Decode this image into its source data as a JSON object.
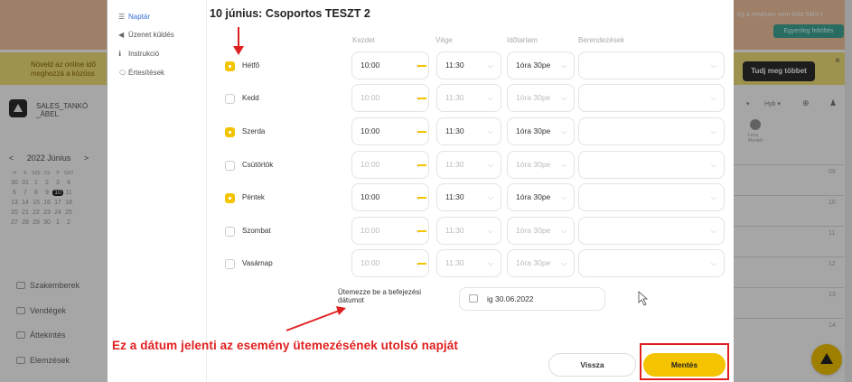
{
  "background": {
    "left_banner": "Növeld az online idő\nmeghozzá a közöss",
    "user_name": "SALES_TANKÓ\n_ÁBEL",
    "calendar": {
      "prev": "<",
      "month": "2022 Június",
      "next": ">",
      "weekdays": [
        "H",
        "K",
        "SZE",
        "CS",
        "P",
        "SZO"
      ],
      "rows": [
        [
          "30",
          "31",
          "1",
          "2",
          "3",
          "4"
        ],
        [
          "6",
          "7",
          "8",
          "9",
          "10",
          "11"
        ],
        [
          "13",
          "14",
          "15",
          "16",
          "17",
          "18"
        ],
        [
          "20",
          "21",
          "22",
          "23",
          "24",
          "25"
        ],
        [
          "27",
          "28",
          "29",
          "30",
          "1",
          "2"
        ]
      ],
      "today": "10"
    },
    "nav": [
      "Szakemberek",
      "Vendégek",
      "Áttekintés",
      "Elemzések"
    ],
    "right_small_text": "ég a rendszer nem küld SMS-t",
    "topup_button": "Egyenleg feltöltés",
    "learn_more_button": "Tudj meg többet",
    "close_x": "×",
    "toolbar_hyb": "Hyb ▾",
    "staff_label": "Lena\nMenkör",
    "hour_labels": [
      "09",
      "10",
      "11",
      "12",
      "13",
      "14"
    ]
  },
  "modal": {
    "sidebar": [
      {
        "icon": "☰",
        "label": "Naptár",
        "active": true
      },
      {
        "icon": "◀",
        "label": "Üzenet küldés",
        "active": false
      },
      {
        "icon": "ℹ",
        "label": "Instrukció",
        "active": false
      },
      {
        "icon": "🗨",
        "label": "Értesítések",
        "active": false
      }
    ],
    "title": "10 június: Csoportos TESZT 2",
    "headers": {
      "start": "Kezdet",
      "end": "Vége",
      "duration": "Időtartam",
      "devices": "Berendezések"
    },
    "days": [
      {
        "label": "Hétfő",
        "checked": true,
        "start": "10:00",
        "end": "11:30",
        "duration": "1óra 30pe"
      },
      {
        "label": "Kedd",
        "checked": false,
        "start": "10:00",
        "end": "11:30",
        "duration": "1óra 30pe"
      },
      {
        "label": "Szerda",
        "checked": true,
        "start": "10:00",
        "end": "11:30",
        "duration": "1óra 30pe"
      },
      {
        "label": "Csütörtök",
        "checked": false,
        "start": "10:00",
        "end": "11:30",
        "duration": "1óra 30pe"
      },
      {
        "label": "Péntek",
        "checked": true,
        "start": "10:00",
        "end": "11:30",
        "duration": "1óra 30pe"
      },
      {
        "label": "Szombat",
        "checked": false,
        "start": "10:00",
        "end": "11:30",
        "duration": "1óra 30pe"
      },
      {
        "label": "Vasárnap",
        "checked": false,
        "start": "10:00",
        "end": "11:30",
        "duration": "1óra 30pe"
      }
    ],
    "end_label": "Ütemezze be a befejezési dátumot",
    "end_date": "ig 30.06.2022",
    "back_button": "Vissza",
    "save_button": "Mentés"
  },
  "annotation": {
    "text": "Ez a dátum jelenti az esemény ütemezésének utolsó napját",
    "color": "#e02020"
  },
  "colors": {
    "accent": "#f5c400",
    "link": "#3a6fd8",
    "teal": "#3fa697"
  }
}
